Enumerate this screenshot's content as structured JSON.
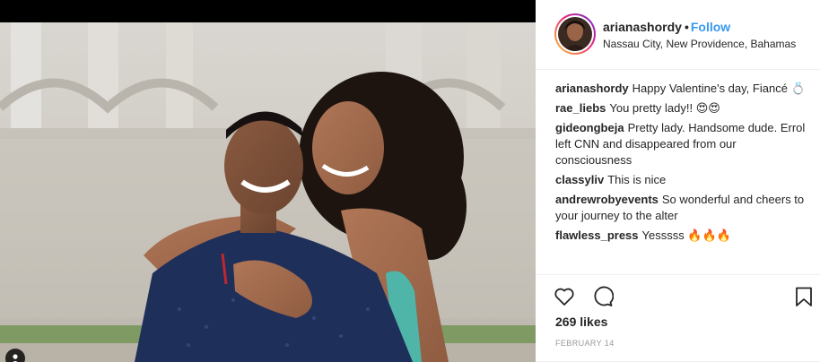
{
  "post": {
    "username": "arianashordy",
    "separator": "•",
    "follow_label": "Follow",
    "location": "Nassau City, New Providence, Bahamas"
  },
  "comments": [
    {
      "user": "arianashordy",
      "text": "Happy Valentine's day, Fiancé 💍"
    },
    {
      "user": "rae_liebs",
      "text": "You pretty lady!! 😍😍"
    },
    {
      "user": "gideongbeja",
      "text": "Pretty lady. Handsome dude. Errol left CNN and disappeared from our consciousness"
    },
    {
      "user": "classyliv",
      "text": "This is nice"
    },
    {
      "user": "andrewrobyevents",
      "text": "So wonderful and cheers to your journey to the alter"
    },
    {
      "user": "flawless_press",
      "text": "Yesssss 🔥🔥🔥"
    }
  ],
  "engagement": {
    "likes": "269 likes",
    "date": "FEBRUARY 14"
  },
  "icons": {
    "like": "heart-icon",
    "comment": "comment-bubble-icon",
    "save": "bookmark-icon",
    "tag": "person-tag-icon"
  },
  "colors": {
    "follow": "#3897f0",
    "text": "#262626",
    "muted": "#999999",
    "divider": "#efefef"
  }
}
